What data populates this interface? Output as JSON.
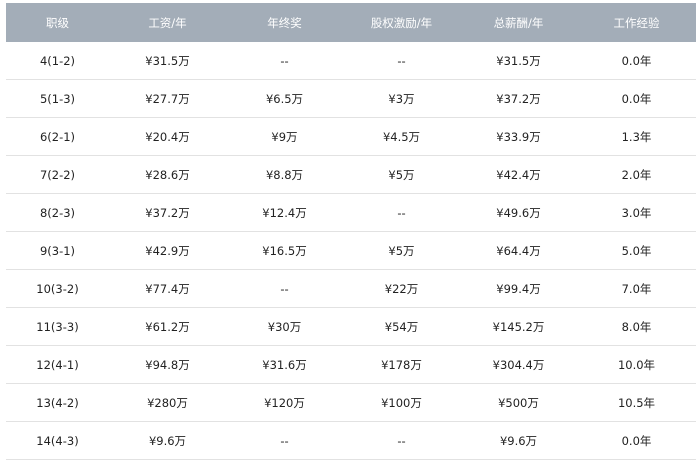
{
  "table": {
    "headers": [
      "职级",
      "工资/年",
      "年终奖",
      "股权激励/年",
      "总薪酬/年",
      "工作经验"
    ],
    "rows": [
      [
        "4(1-2)",
        "¥31.5万",
        "--",
        "--",
        "¥31.5万",
        "0.0年"
      ],
      [
        "5(1-3)",
        "¥27.7万",
        "¥6.5万",
        "¥3万",
        "¥37.2万",
        "0.0年"
      ],
      [
        "6(2-1)",
        "¥20.4万",
        "¥9万",
        "¥4.5万",
        "¥33.9万",
        "1.3年"
      ],
      [
        "7(2-2)",
        "¥28.6万",
        "¥8.8万",
        "¥5万",
        "¥42.4万",
        "2.0年"
      ],
      [
        "8(2-3)",
        "¥37.2万",
        "¥12.4万",
        "--",
        "¥49.6万",
        "3.0年"
      ],
      [
        "9(3-1)",
        "¥42.9万",
        "¥16.5万",
        "¥5万",
        "¥64.4万",
        "5.0年"
      ],
      [
        "10(3-2)",
        "¥77.4万",
        "--",
        "¥22万",
        "¥99.4万",
        "7.0年"
      ],
      [
        "11(3-3)",
        "¥61.2万",
        "¥30万",
        "¥54万",
        "¥145.2万",
        "8.0年"
      ],
      [
        "12(4-1)",
        "¥94.8万",
        "¥31.6万",
        "¥178万",
        "¥304.4万",
        "10.0年"
      ],
      [
        "13(4-2)",
        "¥280万",
        "¥120万",
        "¥100万",
        "¥500万",
        "10.5年"
      ],
      [
        "14(4-3)",
        "¥9.6万",
        "--",
        "--",
        "¥9.6万",
        "0.0年"
      ]
    ]
  },
  "colors": {
    "header_bg": "#a3adb8",
    "header_text": "#ffffff",
    "cell_text": "#222222",
    "row_border": "#e2e2e2"
  }
}
